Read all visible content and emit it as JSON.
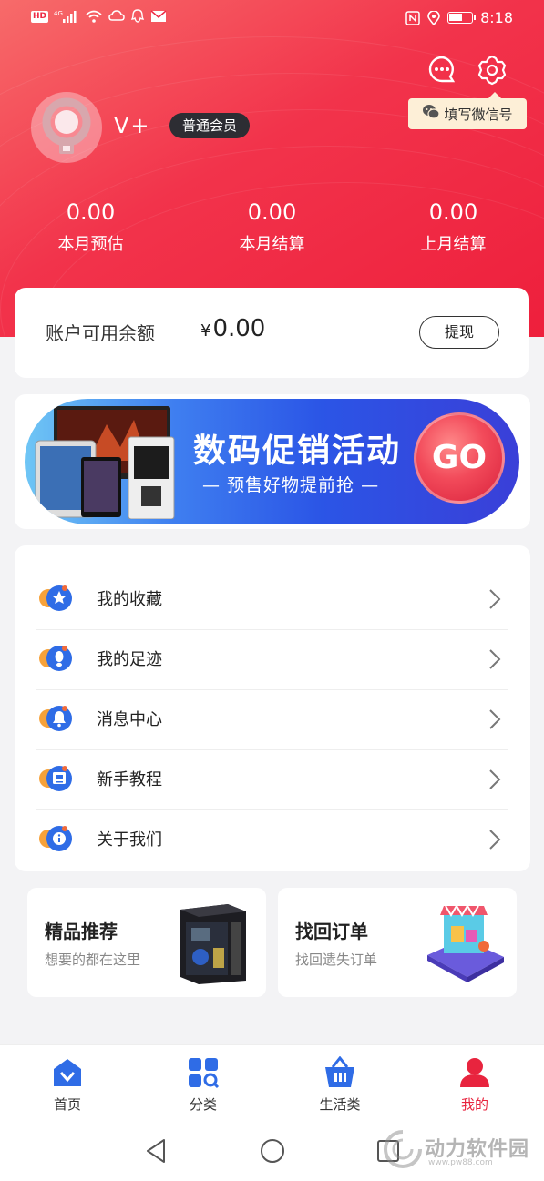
{
  "status_bar": {
    "hd_label": "HD",
    "network_label": "4G",
    "time": "8:18"
  },
  "header": {
    "username": "V+",
    "member_badge": "普通会员",
    "wechat_tip": "填写微信号",
    "stats": [
      {
        "value": "0.00",
        "label": "本月预估"
      },
      {
        "value": "0.00",
        "label": "本月结算"
      },
      {
        "value": "0.00",
        "label": "上月结算"
      }
    ]
  },
  "balance": {
    "label": "账户可用余额",
    "currency": "¥",
    "amount": "0.00",
    "withdraw_label": "提现"
  },
  "banner": {
    "title": "数码促销活动",
    "subtitle": "— 预售好物提前抢 —",
    "go_label": "GO"
  },
  "menu": {
    "items": [
      {
        "label": "我的收藏",
        "icon": "star-icon"
      },
      {
        "label": "我的足迹",
        "icon": "footprint-icon"
      },
      {
        "label": "消息中心",
        "icon": "bell-icon"
      },
      {
        "label": "新手教程",
        "icon": "tutorial-icon"
      },
      {
        "label": "关于我们",
        "icon": "info-icon"
      }
    ]
  },
  "promos": [
    {
      "title": "精品推荐",
      "subtitle": "想要的都在这里"
    },
    {
      "title": "找回订单",
      "subtitle": "找回遗失订单"
    }
  ],
  "tabs": [
    {
      "label": "首页",
      "icon": "home-icon"
    },
    {
      "label": "分类",
      "icon": "category-icon"
    },
    {
      "label": "生活类",
      "icon": "basket-icon"
    },
    {
      "label": "我的",
      "icon": "profile-icon",
      "active": true
    }
  ],
  "watermark": {
    "text": "动力软件园",
    "url": "www.pw88.com"
  },
  "colors": {
    "header_red": "#ee1f3c",
    "accent_blue": "#2f6ce6",
    "active_tab": "#e8243e",
    "tip_bg": "#fdefd7"
  }
}
